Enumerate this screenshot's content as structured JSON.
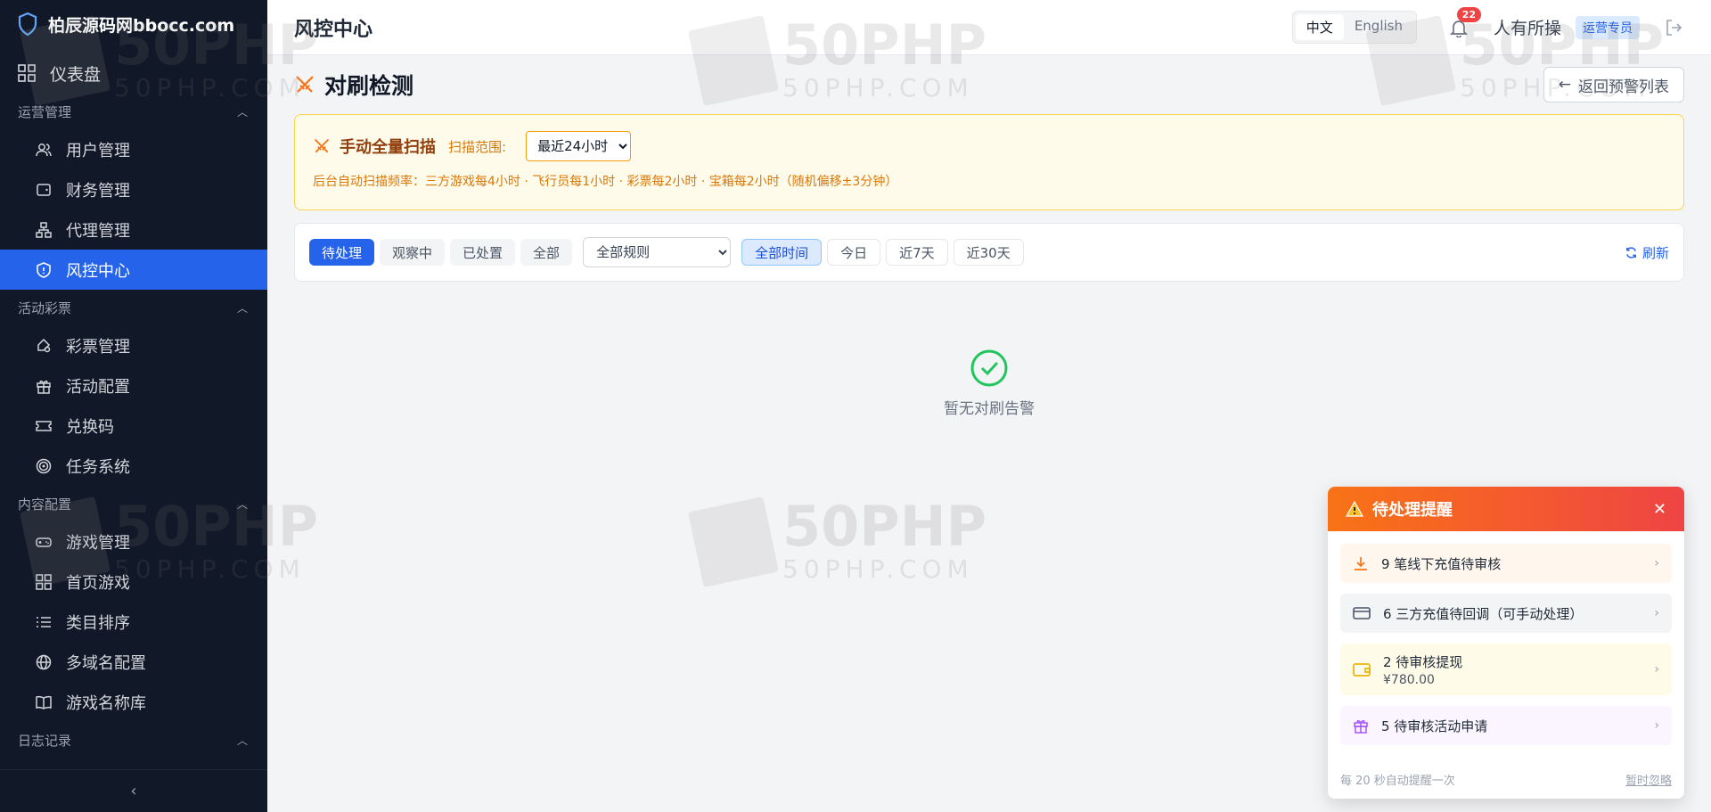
{
  "brand": {
    "name": "柏辰源码网bbocc.com"
  },
  "sidebar": {
    "dashboard": "仪表盘",
    "groups": [
      {
        "label": "运营管理",
        "items": [
          "用户管理",
          "财务管理",
          "代理管理",
          "风控中心"
        ]
      },
      {
        "label": "活动彩票",
        "items": [
          "彩票管理",
          "活动配置",
          "兑换码",
          "任务系统"
        ]
      },
      {
        "label": "内容配置",
        "items": [
          "游戏管理",
          "首页游戏",
          "类目排序",
          "多域名配置",
          "游戏名称库"
        ]
      },
      {
        "label": "日志记录",
        "items": []
      }
    ],
    "active_item": "风控中心"
  },
  "header": {
    "title": "风控中心",
    "lang_zh": "中文",
    "lang_en": "English",
    "notifications": "22",
    "user": "人有所操",
    "role": "运营专员"
  },
  "page": {
    "title": "对刷检测",
    "back_label": "返回预警列表"
  },
  "scan": {
    "title": "手动全量扫描",
    "range_label": "扫描范围:",
    "range_value": "最近24小时",
    "note": "后台自动扫描频率：三方游戏每4小时 · 飞行员每1小时 · 彩票每2小时 · 宝箱每2小时（随机偏移±3分钟）"
  },
  "filters": {
    "status": [
      "待处理",
      "观察中",
      "已处置",
      "全部"
    ],
    "rule_value": "全部规则",
    "time": [
      "全部时间",
      "今日",
      "近7天",
      "近30天"
    ],
    "refresh": "刷新"
  },
  "empty": {
    "text": "暂无对刷告警"
  },
  "popup": {
    "title": "待处理提醒",
    "alerts": [
      {
        "text": "9 笔线下充值待审核"
      },
      {
        "text": "6 三方充值待回调（可手动处理）"
      },
      {
        "text": "2 待审核提现",
        "sub": "¥780.00"
      },
      {
        "text": "5 待审核活动申请"
      }
    ],
    "footer_note": "每 20 秒自动提醒一次",
    "dismiss": "暂时忽略"
  },
  "watermark": {
    "line1": "50PHP",
    "line2": "50PHP.COM"
  },
  "colors": {
    "accent": "#2563eb",
    "sidebar": "#111827",
    "warning": "#f97316",
    "danger": "#ef4444",
    "success": "#22c55e"
  }
}
